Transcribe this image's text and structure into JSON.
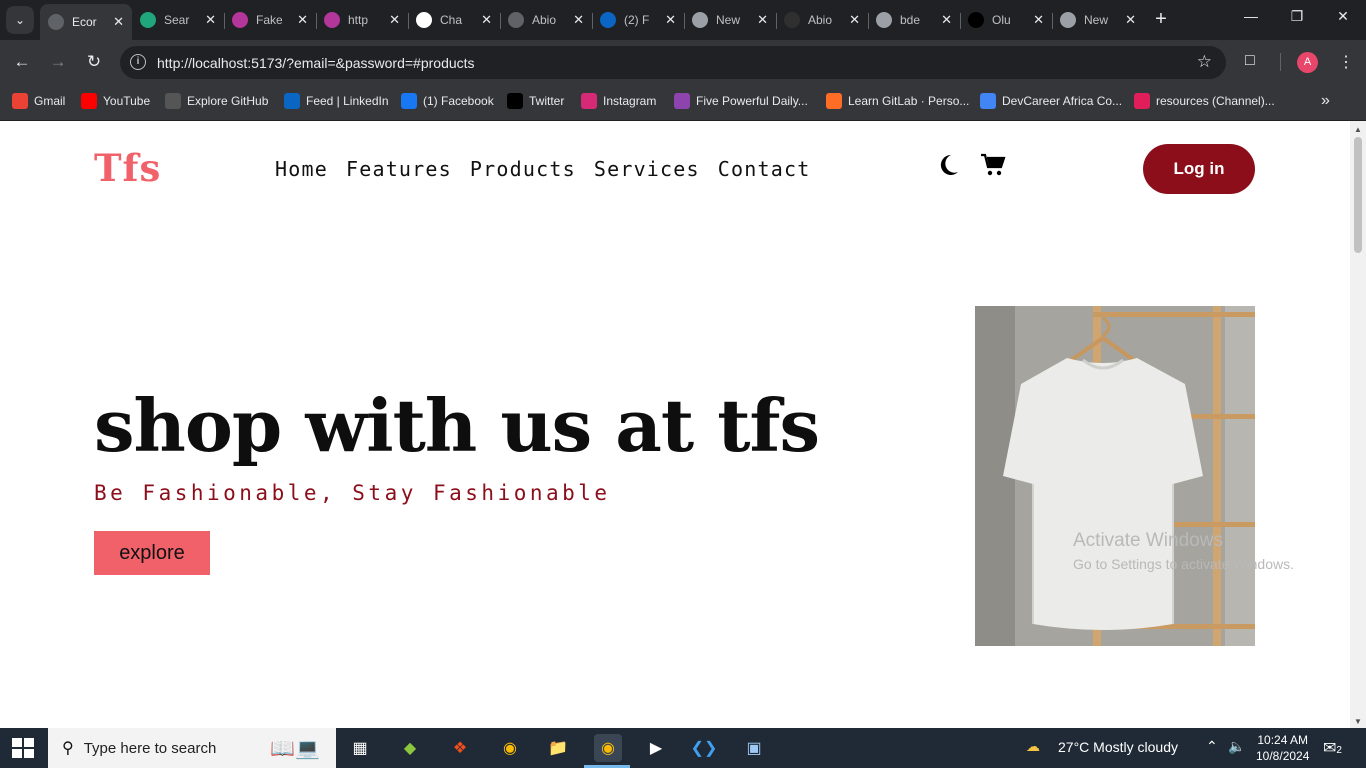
{
  "browser": {
    "tabs": [
      {
        "title": "Ecor",
        "favicon": "globe-icon",
        "color": "#5f6368"
      },
      {
        "title": "Sear",
        "favicon": "d-icon",
        "color": "#1fa67a"
      },
      {
        "title": "Fake",
        "favicon": "graphql-icon",
        "color": "#b3369a"
      },
      {
        "title": "http",
        "favicon": "graphql-icon",
        "color": "#b3369a"
      },
      {
        "title": "Cha",
        "favicon": "chatgpt-icon",
        "color": "#ffffff"
      },
      {
        "title": "Abio",
        "favicon": "loading-icon",
        "color": "#5f6368"
      },
      {
        "title": "(2) F",
        "favicon": "linkedin-icon",
        "color": "#0a66c2"
      },
      {
        "title": "New",
        "favicon": "chrome-icon",
        "color": "#9aa0a6"
      },
      {
        "title": "Abio",
        "favicon": "github-icon",
        "color": "#303030"
      },
      {
        "title": "bde",
        "favicon": "globe-icon",
        "color": "#9aa0a6"
      },
      {
        "title": "Olu",
        "favicon": "x-icon",
        "color": "#000000"
      },
      {
        "title": "New",
        "favicon": "chrome-icon",
        "color": "#9aa0a6"
      }
    ],
    "url": "http://localhost:5173/?email=&password=#products",
    "profile_initial": "A",
    "bookmarks": [
      {
        "label": "Gmail",
        "icon": "gmail-icon",
        "color": "#ea4335"
      },
      {
        "label": "YouTube",
        "icon": "youtube-icon",
        "color": "#ff0000"
      },
      {
        "label": "Explore GitHub",
        "icon": "github-icon",
        "color": "#555555"
      },
      {
        "label": "Feed | LinkedIn",
        "icon": "linkedin-icon",
        "color": "#0a66c2"
      },
      {
        "label": "(1) Facebook",
        "icon": "facebook-icon",
        "color": "#1877f2"
      },
      {
        "label": "Twitter",
        "icon": "x-icon",
        "color": "#000000"
      },
      {
        "label": "Instagram",
        "icon": "instagram-icon",
        "color": "#d62976"
      },
      {
        "label": "Five Powerful Daily...",
        "icon": "bookmark-icon",
        "color": "#8e44ad"
      },
      {
        "label": "Learn GitLab · Perso...",
        "icon": "gitlab-icon",
        "color": "#fc6d26"
      },
      {
        "label": "DevCareer Africa Co...",
        "icon": "docs-icon",
        "color": "#4285f4"
      },
      {
        "label": "resources (Channel)...",
        "icon": "slack-icon",
        "color": "#e01e5a"
      }
    ]
  },
  "site": {
    "logo": "Tfs",
    "nav": [
      "Home",
      "Features",
      "Products",
      "Services",
      "Contact"
    ],
    "login_label": "Log in",
    "hero": {
      "title": "shop with us at tfs",
      "subtitle": "Be Fashionable, Stay Fashionable",
      "cta": "explore"
    },
    "colors": {
      "brand": "#f0616a",
      "accent": "#8b0e1a"
    }
  },
  "watermark": {
    "line1": "Activate Windows",
    "line2": "Go to Settings to activate Windows."
  },
  "taskbar": {
    "search_placeholder": "Type here to search",
    "weather": "27°C  Mostly cloudy",
    "time": "10:24 AM",
    "date": "10/8/2024",
    "notifications": "2"
  }
}
